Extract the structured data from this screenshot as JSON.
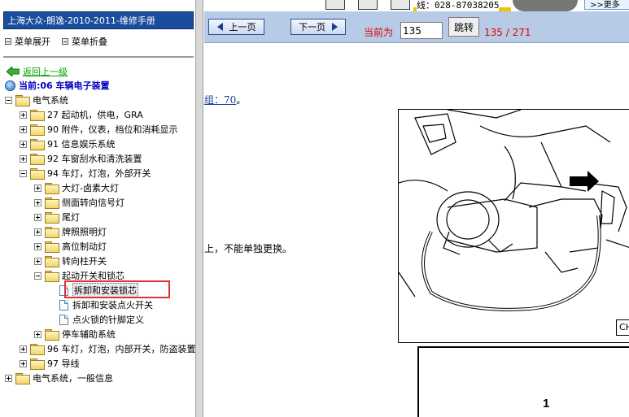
{
  "window": {
    "title": "上海大众-朗逸-2010-2011-维修手册"
  },
  "topstrip": {
    "phone": "线：028-87038205",
    "more": ">>更多"
  },
  "menu": {
    "expand_label": "菜单展开",
    "collapse_label": "菜单折叠"
  },
  "back_label": "返回上一级",
  "current_label": "当前:06  车辆电子装置",
  "tree": [
    {
      "label": "电气系统",
      "depth": 0,
      "type": "folder",
      "expanded": true
    },
    {
      "label": "27 起动机，供电，GRA",
      "depth": 1,
      "type": "folder",
      "expanded": false
    },
    {
      "label": "90 附件，仪表，档位和消耗显示",
      "depth": 1,
      "type": "folder",
      "expanded": false
    },
    {
      "label": "91 信息娱乐系统",
      "depth": 1,
      "type": "folder",
      "expanded": false
    },
    {
      "label": "92 车窗刮水和清洗装置",
      "depth": 1,
      "type": "folder",
      "expanded": false
    },
    {
      "label": "94 车灯，灯泡，外部开关",
      "depth": 1,
      "type": "folder",
      "expanded": true
    },
    {
      "label": "大灯-卤素大灯",
      "depth": 2,
      "type": "folder",
      "expanded": false
    },
    {
      "label": "侧面转向信号灯",
      "depth": 2,
      "type": "folder",
      "expanded": false
    },
    {
      "label": "尾灯",
      "depth": 2,
      "type": "folder",
      "expanded": false
    },
    {
      "label": "牌照照明灯",
      "depth": 2,
      "type": "folder",
      "expanded": false
    },
    {
      "label": "高位制动灯",
      "depth": 2,
      "type": "folder",
      "expanded": false
    },
    {
      "label": "转向柱开关",
      "depth": 2,
      "type": "folder",
      "expanded": false
    },
    {
      "label": "起动开关和锁芯",
      "depth": 2,
      "type": "folder",
      "expanded": true
    },
    {
      "label": "拆卸和安装锁芯",
      "depth": 3,
      "type": "doc",
      "selected": true
    },
    {
      "label": "拆卸和安装点火开关",
      "depth": 3,
      "type": "doc"
    },
    {
      "label": "点火锁的针脚定义",
      "depth": 3,
      "type": "doc"
    },
    {
      "label": "停车辅助系统",
      "depth": 2,
      "type": "folder",
      "expanded": false
    },
    {
      "label": "96 车灯，灯泡，内部开关，防盗装置",
      "depth": 1,
      "type": "folder",
      "expanded": false
    },
    {
      "label": "97 导线",
      "depth": 1,
      "type": "folder",
      "expanded": false
    },
    {
      "label": "电气系统，一般信息",
      "depth": 0,
      "type": "folder",
      "expanded": false
    }
  ],
  "nav": {
    "prev_label": "上一页",
    "next_label": "下一页",
    "current_prefix": "当前为",
    "page_value": "135",
    "jump_label": "跳转",
    "page_count": "135 / 271"
  },
  "content": {
    "fragment1_link": "组：70",
    "fragment1_tail": "。",
    "fragment2": "上，不能单独更换。",
    "figure_label": "CH",
    "box_number": "1"
  },
  "colors": {
    "titlebar": "#1a4d9e",
    "navbar": "#b7cbe6",
    "accent_red": "#e00000",
    "highlight_box": "#e03030"
  }
}
